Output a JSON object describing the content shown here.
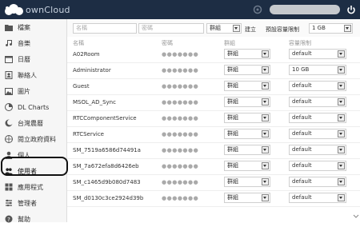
{
  "header": {
    "logo_text": "ownCloud",
    "icons": [
      "owncloud-logo-icon",
      "settings-icon",
      "power-icon"
    ],
    "colors": {
      "header_bg": "#1d2d44",
      "sidebar_bg": "#f6f6f6"
    }
  },
  "sidebar": {
    "items": [
      {
        "label": "檔案",
        "icon": "folder-icon"
      },
      {
        "label": "音樂",
        "icon": "music-icon"
      },
      {
        "label": "日曆",
        "icon": "calendar-icon"
      },
      {
        "label": "聯絡人",
        "icon": "contacts-icon"
      },
      {
        "label": "圖片",
        "icon": "image-icon"
      },
      {
        "label": "DL Charts",
        "icon": "chart-icon"
      },
      {
        "label": "台灣農曆",
        "icon": "calendar-lunar-icon"
      },
      {
        "label": "閱立政府資料",
        "icon": "opendata-icon"
      },
      {
        "label": "個人",
        "icon": "person-icon"
      },
      {
        "label": "使用者",
        "icon": "users-icon"
      },
      {
        "label": "應用程式",
        "icon": "apps-icon"
      },
      {
        "label": "管理者",
        "icon": "admin-icon"
      },
      {
        "label": "幫助",
        "icon": "help-icon"
      }
    ]
  },
  "toolbar": {
    "name_placeholder": "名稱",
    "password_placeholder": "密碼",
    "group_value": "群組",
    "create_label": "建立",
    "default_quota_label": "預設容量限制",
    "default_quota_value": "1 GB"
  },
  "table": {
    "headers": [
      "名稱",
      "密碼",
      "群組",
      "容量限制"
    ],
    "rows": [
      {
        "name": "A02Room",
        "password": "●●●●●●●",
        "group": "群組",
        "quota": "default"
      },
      {
        "name": "Administrator",
        "password": "●●●●●●●",
        "group": "群組",
        "quota": "10 GB"
      },
      {
        "name": "Guest",
        "password": "●●●●●●●",
        "group": "群組",
        "quota": "default"
      },
      {
        "name": "MSOL_AD_Sync",
        "password": "●●●●●●●",
        "group": "群組",
        "quota": "default"
      },
      {
        "name": "RTCComponentService",
        "password": "●●●●●●●",
        "group": "群組",
        "quota": "default"
      },
      {
        "name": "RTCService",
        "password": "●●●●●●●",
        "group": "群組",
        "quota": "default"
      },
      {
        "name": "SM_7519a6586d74491a",
        "password": "●●●●●●●",
        "group": "群組",
        "quota": "default"
      },
      {
        "name": "SM_7a672efa8d6426eb",
        "password": "●●●●●●●",
        "group": "群組",
        "quota": "default"
      },
      {
        "name": "SM_c1465d9b080d7483",
        "password": "●●●●●●●",
        "group": "群組",
        "quota": "default"
      },
      {
        "name": "SM_d0130c3ce2924d39b",
        "password": "●●●●●●●",
        "group": "群組",
        "quota": "default"
      }
    ]
  }
}
